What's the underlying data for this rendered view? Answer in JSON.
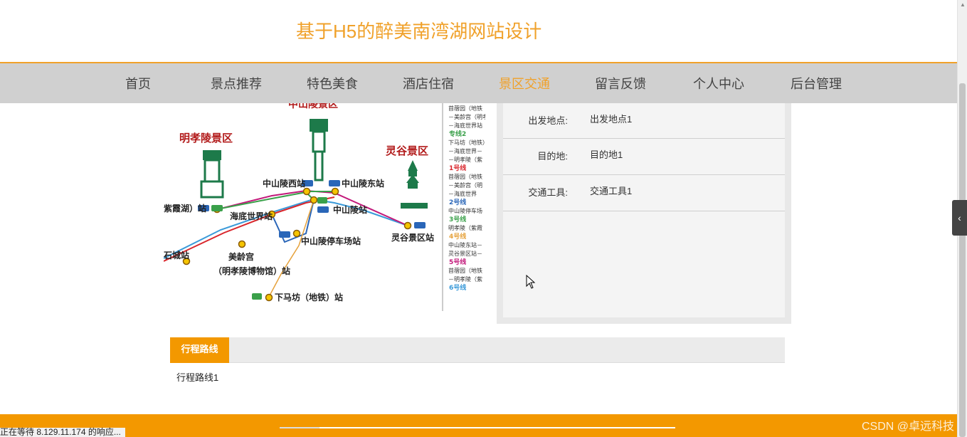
{
  "site": {
    "title": "基于H5的醉美南湾湖网站设计"
  },
  "nav": {
    "items": [
      {
        "label": "首页"
      },
      {
        "label": "景点推荐"
      },
      {
        "label": "特色美食"
      },
      {
        "label": "酒店住宿"
      },
      {
        "label": "景区交通"
      },
      {
        "label": "留言反馈"
      },
      {
        "label": "个人中心"
      },
      {
        "label": "后台管理"
      }
    ],
    "active": "景区交通"
  },
  "map": {
    "labels": {
      "top_area": "中山陵景区",
      "left_area": "明孝陵景区",
      "right_area": "灵谷景区",
      "station_zsl_west": "中山陵西站",
      "station_zsl_east": "中山陵东站",
      "station_zsl": "中山陵站",
      "station_haidi": "海底世界站",
      "station_ziwei": "紫霞湖）站",
      "station_zsl_parking": "中山陵停车场站",
      "station_linggu": "灵谷景区站",
      "station_meiling": "美龄宫",
      "station_meiling_sub": "（明孝陵博物馆）站",
      "station_cheng": "石城站",
      "station_xiamafang": "下马坊（地铁）站"
    },
    "legend": {
      "lines": [
        {
          "label": "专线2",
          "color": "#3aa04a"
        },
        {
          "label": "1号线",
          "color": "#d9262c"
        },
        {
          "label": "2号线",
          "color": "#2a66b8"
        },
        {
          "label": "3号线",
          "color": "#3aa04a"
        },
        {
          "label": "4号线",
          "color": "#e6a23c"
        },
        {
          "label": "5号线",
          "color": "#c2187a"
        },
        {
          "label": "6号线",
          "color": "#3a9ad9"
        }
      ],
      "notes": [
        "苜蓿园（地铁",
        "－美龄宫（明孝",
        "－海底世界站",
        "下马坊（地铁）",
        "－海底世界－",
        "－明孝陵（紫",
        "苜蓿园（地铁",
        "－美龄宫（明",
        "－海底世界",
        "中山陵停车场",
        "明孝陵（紫霞",
        "中山陵东站－",
        "灵谷景区站－",
        "苜蓿园（地铁",
        "－明孝陵（紫"
      ]
    }
  },
  "info": {
    "rows": [
      {
        "label": "出发地点:",
        "value": "出发地点1"
      },
      {
        "label": "目的地:",
        "value": "目的地1"
      },
      {
        "label": "交通工具:",
        "value": "交通工具1"
      }
    ]
  },
  "tabs": {
    "active_label": "行程路线"
  },
  "route": {
    "text": "行程路线1"
  },
  "status": {
    "text": "正在等待 8.129.11.174 的响应..."
  },
  "watermark": {
    "text": "CSDN @卓远科技"
  },
  "colors": {
    "accent": "#f39800",
    "title": "#f0a12a",
    "nav_bg": "#d0d0d0"
  }
}
